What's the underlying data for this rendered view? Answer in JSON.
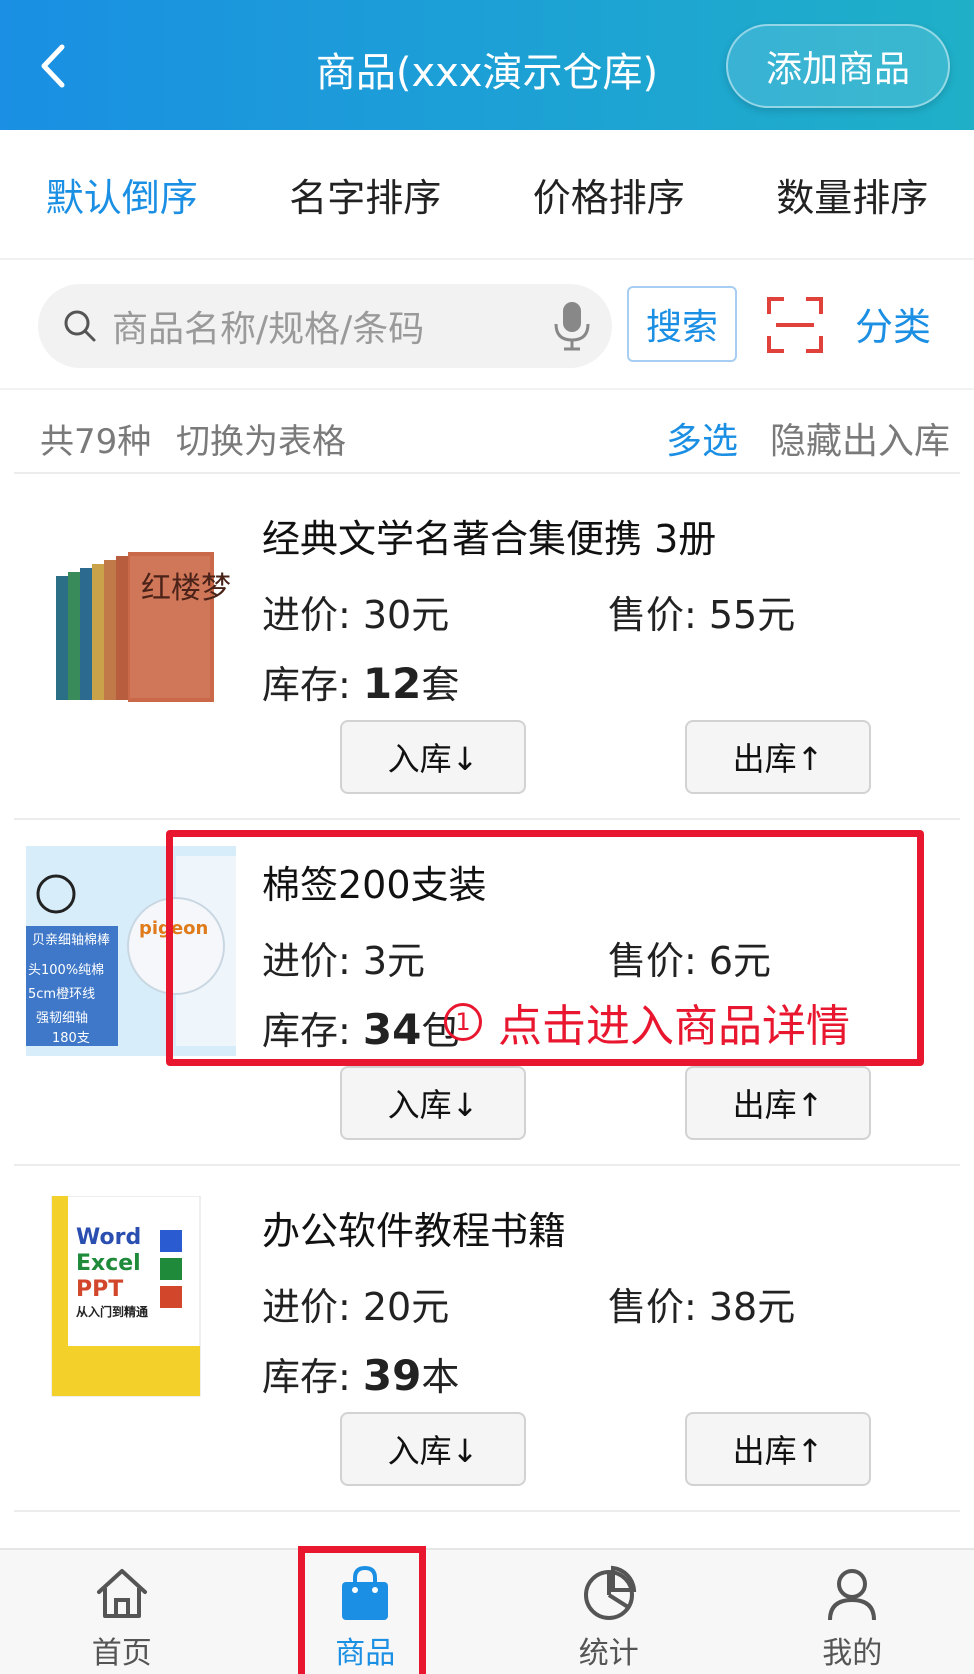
{
  "header": {
    "title": "商品(xxx演示仓库)",
    "add_label": "添加商品"
  },
  "sort_tabs": [
    "默认倒序",
    "名字排序",
    "价格排序",
    "数量排序"
  ],
  "search": {
    "placeholder": "商品名称/规格/条码",
    "button_label": "搜索",
    "category_label": "分类"
  },
  "summary": {
    "count": "共79种",
    "switch_table": "切换为表格",
    "multi_select": "多选",
    "hide_io": "隐藏出入库"
  },
  "products": [
    {
      "name": "经典文学名著合集便携  3册",
      "cost": "进价: 30元",
      "price": "售价: 55元",
      "stock_prefix": "库存: ",
      "stock_num": "12",
      "stock_unit": "套",
      "in_label": "入库↓",
      "out_label": "出库↑",
      "thumb_text": "红楼梦"
    },
    {
      "name": "棉签200支装",
      "cost": "进价: 3元",
      "price": "售价: 6元",
      "stock_prefix": "库存: ",
      "stock_num": "34",
      "stock_unit": "包",
      "in_label": "入库↓",
      "out_label": "出库↑",
      "thumb_lines": [
        "贝亲细轴棉棒",
        "头100%纯棉",
        "5cm橙环线",
        "强韧细轴",
        "180支"
      ],
      "thumb_brand": "pigeon"
    },
    {
      "name": "办公软件教程书籍",
      "cost": "进价: 20元",
      "price": "售价: 38元",
      "stock_prefix": "库存: ",
      "stock_num": "39",
      "stock_unit": "本",
      "in_label": "入库↓",
      "out_label": "出库↑",
      "thumb_lines": [
        "Word",
        "Excel",
        "PPT",
        "从入门到精通"
      ]
    }
  ],
  "annotation": {
    "number": "1",
    "text": "点击进入商品详情"
  },
  "bottom_nav": [
    {
      "label": "首页",
      "icon": "home-icon"
    },
    {
      "label": "商品",
      "icon": "bag-icon"
    },
    {
      "label": "统计",
      "icon": "pie-chart-icon"
    },
    {
      "label": "我的",
      "icon": "user-icon"
    }
  ],
  "colors": {
    "accent": "#1a8fe3",
    "annotation": "#e8162e"
  }
}
